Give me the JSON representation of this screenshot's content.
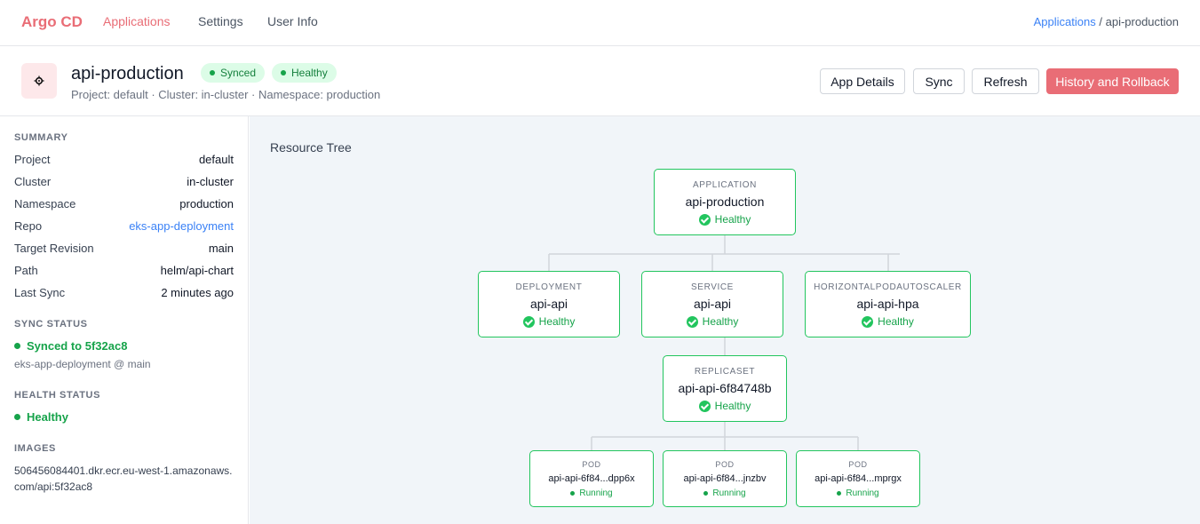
{
  "nav": {
    "brand": "Argo CD",
    "links": [
      "Applications",
      "Settings",
      "User Info"
    ],
    "breadcrumb": {
      "link": "Applications",
      "separator": "/",
      "current": "api-production"
    }
  },
  "app": {
    "icon": "kubernetes-wheel-icon",
    "name": "api-production",
    "sync_badge": "Synced",
    "health_badge": "Healthy",
    "meta": "Project: default · Cluster: in-cluster · Namespace: production",
    "buttons": {
      "details": "App Details",
      "sync": "Sync",
      "refresh": "Refresh",
      "history": "History and Rollback"
    }
  },
  "sidebar": {
    "summary_title": "SUMMARY",
    "summary": [
      {
        "key": "Project",
        "value": "default"
      },
      {
        "key": "Cluster",
        "value": "in-cluster"
      },
      {
        "key": "Namespace",
        "value": "production"
      },
      {
        "key": "Repo",
        "value": "eks-app-deployment"
      },
      {
        "key": "Target Revision",
        "value": "main"
      },
      {
        "key": "Path",
        "value": "helm/api-chart"
      },
      {
        "key": "Last Sync",
        "value": "2 minutes ago"
      }
    ],
    "sync_title": "SYNC STATUS",
    "sync_status": "Synced to 5f32ac8",
    "sync_source": "eks-app-deployment @ main",
    "health_title": "HEALTH STATUS",
    "health_status": "Healthy",
    "images_title": "IMAGES",
    "image": "506456084401.dkr.ecr.eu-west-1.amazonaws.com/api:5f32ac8"
  },
  "tree": {
    "title": "Resource Tree",
    "application": {
      "kind": "APPLICATION",
      "name": "api-production",
      "health": "Healthy"
    },
    "deployment": {
      "kind": "DEPLOYMENT",
      "name": "api-api",
      "health": "Healthy"
    },
    "service": {
      "kind": "SERVICE",
      "name": "api-api",
      "health": "Healthy"
    },
    "hpa": {
      "kind": "HORIZONTALPODAUTOSCALER",
      "name": "api-api-hpa",
      "health": "Healthy"
    },
    "replicaset": {
      "kind": "REPLICASET",
      "name": "api-api-6f84748b",
      "health": "Healthy"
    },
    "pods": [
      {
        "kind": "POD",
        "name": "api-api-6f84...dpp6x",
        "status": "Running"
      },
      {
        "kind": "POD",
        "name": "api-api-6f84...jnzbv",
        "status": "Running"
      },
      {
        "kind": "POD",
        "name": "api-api-6f84...mprgx",
        "status": "Running"
      }
    ]
  },
  "colors": {
    "accent": "#e96d76",
    "healthy": "#22c55e",
    "link": "#3b82f6",
    "canvas": "#f1f5f9"
  }
}
